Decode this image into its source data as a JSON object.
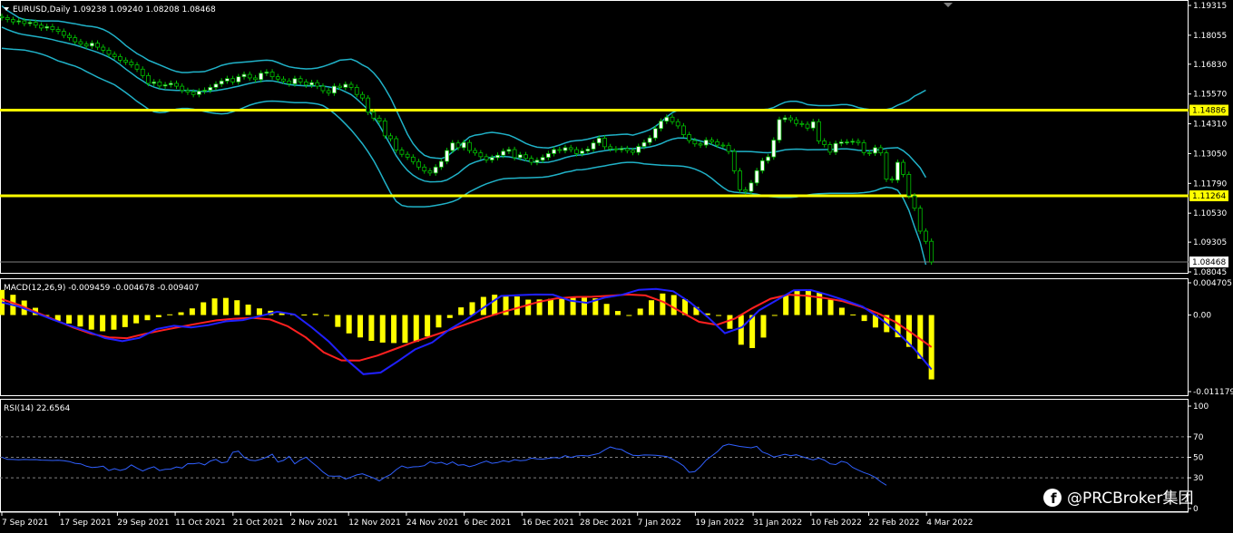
{
  "colors": {
    "background": "#000000",
    "frame": "#ffffff",
    "grid": "#808080",
    "bull_candle": "#ffffff",
    "bear_candle": "#000000",
    "candle_wick": "#00c000",
    "bollinger": "#20b2c8",
    "level_line": "#ffff00",
    "macd_hist": "#ffff00",
    "macd_line": "#2020ff",
    "signal_line": "#ff2020",
    "rsi_line": "#3060ff",
    "watermark": "#ffffff"
  },
  "price_panel": {
    "title": "EURUSD,Daily  1.09238 1.09240 1.08208 1.08468",
    "y_ticks": [
      "1.19315",
      "1.18055",
      "1.16830",
      "1.15570",
      "1.14310",
      "1.13050",
      "1.11790",
      "1.10530",
      "1.09305",
      "1.08045"
    ],
    "level_high": "1.14886",
    "level_low": "1.11264",
    "last_price": "1.08468",
    "scroll_marker_icon": "triangle-down-icon"
  },
  "macd_panel": {
    "title": "MACD(12,26,9) -0.009459 -0.004678 -0.009407",
    "y_ticks": [
      "0.004705",
      "0.00",
      "-0.011179"
    ]
  },
  "rsi_panel": {
    "title": "RSI(14) 22.6564",
    "y_ticks": [
      "100",
      "70",
      "50",
      "30",
      "0"
    ]
  },
  "x_ticks": [
    "7 Sep 2021",
    "17 Sep 2021",
    "29 Sep 2021",
    "11 Oct 2021",
    "21 Oct 2021",
    "2 Nov 2021",
    "12 Nov 2021",
    "24 Nov 2021",
    "6 Dec 2021",
    "16 Dec 2021",
    "28 Dec 2021",
    "7 Jan 2022",
    "19 Jan 2022",
    "31 Jan 2022",
    "10 Feb 2022",
    "22 Feb 2022",
    "4 Mar 2022"
  ],
  "watermark": {
    "text": "@PRCBroker集团",
    "icon": "facebook-icon"
  },
  "chart_data": [
    {
      "type": "candlestick",
      "symbol": "EURUSD",
      "timeframe": "Daily",
      "last_bar": {
        "open": 1.09238,
        "high": 1.0924,
        "low": 1.08208,
        "close": 1.08468
      },
      "ylim": [
        1.08045,
        1.19315
      ],
      "horizontal_levels": [
        1.14886,
        1.11264
      ],
      "close": [
        1.188,
        1.1872,
        1.1862,
        1.1866,
        1.1855,
        1.186,
        1.1848,
        1.1836,
        1.1842,
        1.183,
        1.1822,
        1.1805,
        1.1795,
        1.1778,
        1.1768,
        1.176,
        1.1772,
        1.1755,
        1.1742,
        1.1725,
        1.1715,
        1.17,
        1.1692,
        1.168,
        1.1662,
        1.1635,
        1.1602,
        1.1608,
        1.1591,
        1.1596,
        1.1602,
        1.159,
        1.1572,
        1.1565,
        1.1555,
        1.1569,
        1.1573,
        1.1585,
        1.1599,
        1.1612,
        1.1622,
        1.1608,
        1.163,
        1.164,
        1.1625,
        1.1618,
        1.1645,
        1.165,
        1.163,
        1.162,
        1.1612,
        1.16,
        1.1622,
        1.1608,
        1.1595,
        1.1605,
        1.159,
        1.1571,
        1.1561,
        1.159,
        1.1585,
        1.1598,
        1.1585,
        1.1555,
        1.154,
        1.148,
        1.1455,
        1.1443,
        1.138,
        1.1368,
        1.132,
        1.1302,
        1.129,
        1.1271,
        1.1248,
        1.1232,
        1.1223,
        1.1248,
        1.1272,
        1.1318,
        1.135,
        1.133,
        1.1352,
        1.1318,
        1.1308,
        1.1292,
        1.1278,
        1.1288,
        1.1298,
        1.1315,
        1.1322,
        1.1288,
        1.13,
        1.1285,
        1.1268,
        1.1277,
        1.1289,
        1.1305,
        1.1322,
        1.1318,
        1.133,
        1.1322,
        1.1305,
        1.1316,
        1.1324,
        1.135,
        1.137,
        1.1334,
        1.1325,
        1.1321,
        1.1326,
        1.1318,
        1.131,
        1.1335,
        1.1352,
        1.1371,
        1.1411,
        1.1442,
        1.1459,
        1.144,
        1.1422,
        1.1385,
        1.136,
        1.1346,
        1.1341,
        1.1362,
        1.1355,
        1.1341,
        1.134,
        1.1314,
        1.1232,
        1.1152,
        1.1145,
        1.1181,
        1.1233,
        1.1275,
        1.1291,
        1.1362,
        1.1449,
        1.1456,
        1.1448,
        1.1432,
        1.1429,
        1.1413,
        1.144,
        1.1358,
        1.1343,
        1.1311,
        1.1348,
        1.1354,
        1.1354,
        1.1357,
        1.1351,
        1.1309,
        1.1307,
        1.133,
        1.1308,
        1.1197,
        1.1193,
        1.1268,
        1.1217,
        1.1126,
        1.1074,
        1.0977,
        1.0934,
        1.0847
      ],
      "bollinger_upper": [
        1.193,
        1.191,
        1.1895,
        1.188,
        1.1872,
        1.187,
        1.1868,
        1.1866,
        1.1866,
        1.1866,
        1.1865,
        1.1862,
        1.1858,
        1.1854,
        1.1849,
        1.1845,
        1.1842,
        1.1838,
        1.183,
        1.1818,
        1.1802,
        1.1783,
        1.1762,
        1.1745,
        1.1728,
        1.1715,
        1.17,
        1.169,
        1.168,
        1.167,
        1.166,
        1.1652,
        1.1648,
        1.1648,
        1.165,
        1.165,
        1.1652,
        1.166,
        1.1668,
        1.1678,
        1.1684,
        1.1688,
        1.169,
        1.1692,
        1.1694,
        1.1696,
        1.1699,
        1.17,
        1.1698,
        1.169,
        1.168,
        1.1672,
        1.1668,
        1.1665,
        1.1663,
        1.1664,
        1.1667,
        1.1673,
        1.1681,
        1.169,
        1.17,
        1.1702,
        1.1704,
        1.1695,
        1.168,
        1.1668,
        1.1646,
        1.1618,
        1.1581,
        1.154,
        1.149,
        1.1438,
        1.1387,
        1.1347,
        1.1318,
        1.1298,
        1.1289,
        1.1286,
        1.1284,
        1.1292,
        1.1312,
        1.133,
        1.1355,
        1.1375,
        1.1383,
        1.1386,
        1.1392,
        1.1395,
        1.1392,
        1.1388,
        1.1383,
        1.1373,
        1.1361,
        1.1348,
        1.1339,
        1.1332,
        1.133,
        1.1329,
        1.1334,
        1.1341,
        1.135,
        1.1357,
        1.136,
        1.1362,
        1.1366,
        1.1372,
        1.1378,
        1.1381,
        1.1383,
        1.1384,
        1.1386,
        1.1387,
        1.1383,
        1.139,
        1.1397,
        1.1406,
        1.142,
        1.1438,
        1.146,
        1.1478,
        1.1488,
        1.149,
        1.149,
        1.1489,
        1.1487,
        1.1486,
        1.1487,
        1.1486,
        1.1488,
        1.1486,
        1.1487,
        1.1488,
        1.149,
        1.149,
        1.149,
        1.1491,
        1.1493,
        1.15,
        1.1512,
        1.1522,
        1.1526,
        1.1526,
        1.1521,
        1.1512,
        1.151,
        1.1508,
        1.1508,
        1.1508,
        1.151,
        1.1512,
        1.1512,
        1.1508,
        1.15,
        1.1495,
        1.1492,
        1.149,
        1.1488,
        1.1492,
        1.1497,
        1.151,
        1.1519,
        1.153,
        1.1548,
        1.156,
        1.1573
      ],
      "bollinger_lower": [
        1.175,
        1.1748,
        1.1746,
        1.1745,
        1.1743,
        1.1738,
        1.1733,
        1.1726,
        1.1718,
        1.1708,
        1.1697,
        1.169,
        1.1682,
        1.1675,
        1.1665,
        1.1652,
        1.164,
        1.1628,
        1.1617,
        1.1607,
        1.1596,
        1.158,
        1.1563,
        1.1545,
        1.1526,
        1.151,
        1.1493,
        1.1482,
        1.1478,
        1.148,
        1.1487,
        1.1493,
        1.1496,
        1.1496,
        1.1493,
        1.1488,
        1.1483,
        1.1478,
        1.1475,
        1.1473,
        1.1475,
        1.1482,
        1.149,
        1.15,
        1.151,
        1.1517,
        1.1522,
        1.1526,
        1.1527,
        1.1526,
        1.1524,
        1.1522,
        1.152,
        1.152,
        1.152,
        1.1518,
        1.1515,
        1.1508,
        1.1493,
        1.1475,
        1.1454,
        1.143,
        1.1405,
        1.1377,
        1.1347,
        1.1313,
        1.1275,
        1.1231,
        1.1184,
        1.1139,
        1.1103,
        1.1086,
        1.1081,
        1.108,
        1.108,
        1.108,
        1.1082,
        1.1086,
        1.109,
        1.1095,
        1.1102,
        1.1112,
        1.1128,
        1.1143,
        1.1155,
        1.1167,
        1.1177,
        1.1185,
        1.1193,
        1.1198,
        1.12,
        1.1201,
        1.1202,
        1.1202,
        1.1203,
        1.1204,
        1.1205,
        1.1208,
        1.1213,
        1.1219,
        1.1226,
        1.123,
        1.1236,
        1.1237,
        1.124,
        1.1245,
        1.1249,
        1.1253,
        1.1258,
        1.1262,
        1.1266,
        1.1268,
        1.1268,
        1.1266,
        1.1262,
        1.126,
        1.1258,
        1.1256,
        1.1255,
        1.1254,
        1.1253,
        1.1251,
        1.1247,
        1.124,
        1.123,
        1.1217,
        1.12,
        1.118,
        1.1162,
        1.1147,
        1.1142,
        1.114,
        1.1138,
        1.1136,
        1.1133,
        1.1128,
        1.1124,
        1.1122,
        1.112,
        1.112,
        1.112,
        1.1122,
        1.1126,
        1.113,
        1.1133,
        1.1135,
        1.1136,
        1.1137,
        1.1137,
        1.1137,
        1.1137,
        1.1137,
        1.1138,
        1.114,
        1.1143,
        1.1148,
        1.1157,
        1.1163,
        1.116,
        1.115,
        1.1115,
        1.1065,
        1.0995,
        1.093,
        1.0835
      ],
      "xlabel": "",
      "ylabel": ""
    },
    {
      "type": "bar",
      "name": "MACD(12,26,9)",
      "ylim": [
        -0.011179,
        0.004705
      ],
      "histogram": [
        0.00367,
        0.00296,
        0.00212,
        0.00106,
        -0.00011,
        -0.00087,
        -0.00124,
        -0.00168,
        -0.00213,
        -0.00237,
        -0.00214,
        -0.00176,
        -0.00121,
        -0.00075,
        -0.00032,
        0.0001,
        0.0004,
        0.00097,
        0.00186,
        0.00243,
        0.0025,
        0.00216,
        0.00152,
        0.00097,
        0.00062,
        0.00025,
        0.00011,
        7e-05,
        0.00018,
        0.0,
        -0.00173,
        -0.00268,
        -0.00327,
        -0.00377,
        -0.00402,
        -0.00409,
        -0.00406,
        -0.00391,
        -0.00313,
        -0.00181,
        -0.00043,
        0.00112,
        0.00187,
        0.00265,
        0.00297,
        0.00292,
        0.00271,
        0.00225,
        0.00227,
        0.00237,
        0.00252,
        0.00256,
        0.00269,
        0.00244,
        0.00163,
        0.00059,
        0.0,
        0.00094,
        0.00216,
        0.00314,
        0.00292,
        0.00232,
        0.00117,
        0.00024,
        -4e-05,
        -0.00201,
        -0.00434,
        -0.00482,
        -0.00329,
        1e-05,
        0.0029,
        0.00357,
        0.00366,
        0.00327,
        0.00224,
        0.00107,
        8e-05,
        -0.00087,
        -0.00182,
        -0.0025,
        -0.00325,
        -0.00465,
        -0.00637,
        -0.0094
      ],
      "macd": [
        0.00186,
        0.00123,
        0.00027,
        -0.00069,
        -0.0016,
        -0.0024,
        -0.00337,
        -0.00381,
        -0.00333,
        -0.00203,
        -0.00157,
        -0.00181,
        -0.00147,
        -0.00092,
        -0.00074,
        -0.00015,
        0.00048,
        8e-05,
        -0.00179,
        -0.00389,
        -0.00646,
        -0.00864,
        -0.0084,
        -0.00677,
        -0.00503,
        -0.004,
        -0.00211,
        -0.00063,
        0.00111,
        0.00279,
        0.00291,
        0.003,
        0.00298,
        0.00211,
        0.00178,
        0.00254,
        0.00295,
        0.00369,
        0.0038,
        0.00348,
        0.00182,
        -0.00028,
        -0.00266,
        -0.00178,
        0.00071,
        0.00215,
        0.0036,
        0.00365,
        0.00294,
        0.00213,
        0.00122,
        -0.00044,
        -0.00247,
        -0.00493,
        -0.00794
      ],
      "signal": [
        0.00231,
        0.00143,
        0.00033,
        -0.00075,
        -0.00182,
        -0.00273,
        -0.00327,
        -0.00338,
        -0.00275,
        -0.00222,
        -0.00172,
        -0.00123,
        -0.00078,
        -0.00054,
        -0.00041,
        -0.00064,
        -0.00165,
        -0.00327,
        -0.00543,
        -0.00662,
        -0.00665,
        -0.00593,
        -0.00496,
        -0.00398,
        -0.0031,
        -0.00223,
        -0.00131,
        -0.00041,
        0.00042,
        0.00114,
        0.0019,
        0.00242,
        0.00263,
        0.00267,
        0.00283,
        0.003,
        0.00287,
        0.00193,
        0.00045,
        -0.00099,
        -0.00143,
        -0.00052,
        0.00103,
        0.00237,
        0.00297,
        0.00283,
        0.00249,
        0.00204,
        0.00126,
        0.00026,
        -0.00104,
        -0.00281,
        -0.00468
      ],
      "xlabel": "",
      "ylabel": ""
    },
    {
      "type": "line",
      "name": "RSI(14)",
      "ylim": [
        0,
        100
      ],
      "levels": [
        70,
        50,
        30
      ],
      "values": [
        50.2,
        48.0,
        47.9,
        47.5,
        47.9,
        47.7,
        47.8,
        47.3,
        47.2,
        46.9,
        47.1,
        46.7,
        45.8,
        44.2,
        43.6,
        41.3,
        40.1,
        40.5,
        41.3,
        37.1,
        38.9,
        37.2,
        38.6,
        42.6,
        39.5,
        36.6,
        39.0,
        40.8,
        37.1,
        38.3,
        38.5,
        40.6,
        39.6,
        43.8,
        43.7,
        44.5,
        42.6,
        46.4,
        48.0,
        44.6,
        45.5,
        55.0,
        56.0,
        50.0,
        47.3,
        46.7,
        48.1,
        50.2,
        53.1,
        45.4,
        47.0,
        50.9,
        43.6,
        47.5,
        50.1,
        45.2,
        40.8,
        35.7,
        31.9,
        31.5,
        31.8,
        28.8,
        30.7,
        32.8,
        34.0,
        31.9,
        29.8,
        27.0,
        30.5,
        33.2,
        38.0,
        41.6,
        39.7,
        40.7,
        41.0,
        41.9,
        45.7,
        44.2,
        45.1,
        42.9,
        45.5,
        42.3,
        42.8,
        40.9,
        42.3,
        44.5,
        46.3,
        44.2,
        44.9,
        46.6,
        45.6,
        47.7,
        46.6,
        47.1,
        49.2,
        48.5,
        48.2,
        49.0,
        49.8,
        49.2,
        51.6,
        49.8,
        51.3,
        51.8,
        51.3,
        52.6,
        53.8,
        57.3,
        60.1,
        58.4,
        57.6,
        54.4,
        52.0,
        51.7,
        52.3,
        52.2,
        52.0,
        51.4,
        50.8,
        48.3,
        45.3,
        41.6,
        35.4,
        36.0,
        40.9,
        47.3,
        51.3,
        55.5,
        61.1,
        62.8,
        61.8,
        60.6,
        60.0,
        59.3,
        60.7,
        55.1,
        53.2,
        50.3,
        51.6,
        53.0,
        51.6,
        52.5,
        50.7,
        48.9,
        47.5,
        49.2,
        47.3,
        43.6,
        42.9,
        46.1,
        44.8,
        40.2,
        37.5,
        35.1,
        33.3,
        30.4,
        26.1,
        22.7
      ],
      "xlabel": "",
      "ylabel": ""
    }
  ]
}
